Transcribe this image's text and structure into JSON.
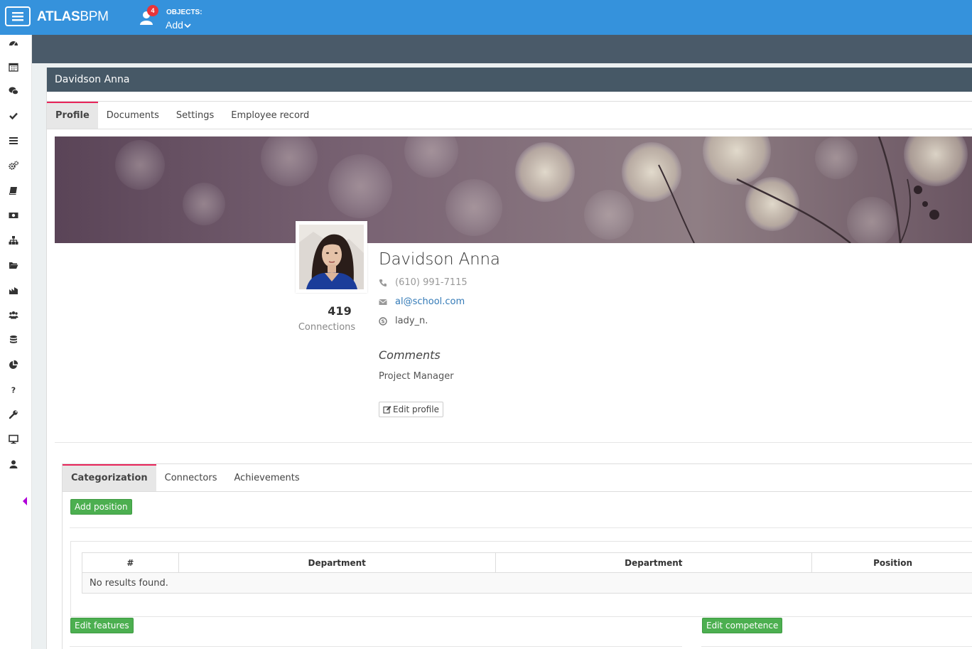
{
  "app": {
    "logo_bold": "ATLAS",
    "logo_light": "BPM",
    "notification_count": "4",
    "objects_label": "OBJECTS:",
    "add_label": "Add"
  },
  "sidebar": {
    "items": [
      "dashboard-icon",
      "calendar-icon",
      "chat-icon",
      "check-icon",
      "list-icon",
      "cogs-icon",
      "book-icon",
      "money-icon",
      "sitemap-icon",
      "folder-icon",
      "chart-icon",
      "users-icon",
      "database-icon",
      "pie-chart-icon",
      "question-icon",
      "wrench-icon",
      "desktop-icon",
      "user-icon"
    ]
  },
  "page": {
    "title": "Davidson Anna",
    "tabs": [
      "Profile",
      "Documents",
      "Settings",
      "Employee record"
    ]
  },
  "profile": {
    "name": "Davidson Anna",
    "phone": "(610) 991-7115",
    "email": "al@school.com",
    "skype": "lady_n.",
    "connections_count": "419",
    "connections_label": "Connections",
    "comments_heading": "Comments",
    "comments_value": "Project Manager",
    "edit_button": "Edit profile"
  },
  "lower": {
    "tabs": [
      "Categorization",
      "Connectors",
      "Achievements"
    ],
    "add_position": "Add position",
    "table": {
      "headers": [
        "#",
        "Department",
        "Department",
        "Position"
      ],
      "empty": "No results found."
    },
    "edit_features": "Edit features",
    "edit_competence": "Edit competence"
  },
  "colors": {
    "topbar": "#3592dc",
    "header": "#465866",
    "accent": "#e8255a",
    "green": "#4caf50",
    "link": "#337ab7"
  }
}
